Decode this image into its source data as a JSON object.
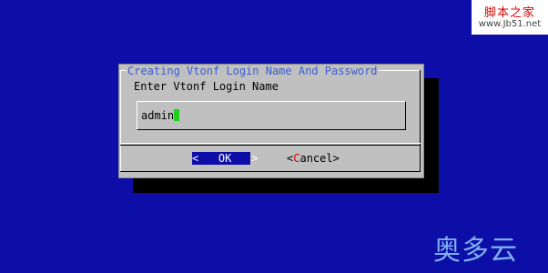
{
  "watermark_top": {
    "line1": "脚本之家",
    "line2": "www.Jb51.net"
  },
  "watermark_bottom": {
    "text": "奥多云"
  },
  "dialog": {
    "title": "Creating Vtonf Login Name And Password",
    "prompt": "Enter Vtonf Login Name",
    "input_value": "admin",
    "ok_button": {
      "left": "<",
      "label": "OK",
      "right": ">"
    },
    "cancel_button": {
      "left": "<",
      "hotkey": "C",
      "rest": "ancel",
      "right": ">"
    }
  },
  "colors": {
    "background": "#0d0da8",
    "dialog": "#c0c0c0",
    "title_text": "#3b5fcf",
    "cursor": "#1cd21c",
    "hotkey": "#d80000"
  }
}
